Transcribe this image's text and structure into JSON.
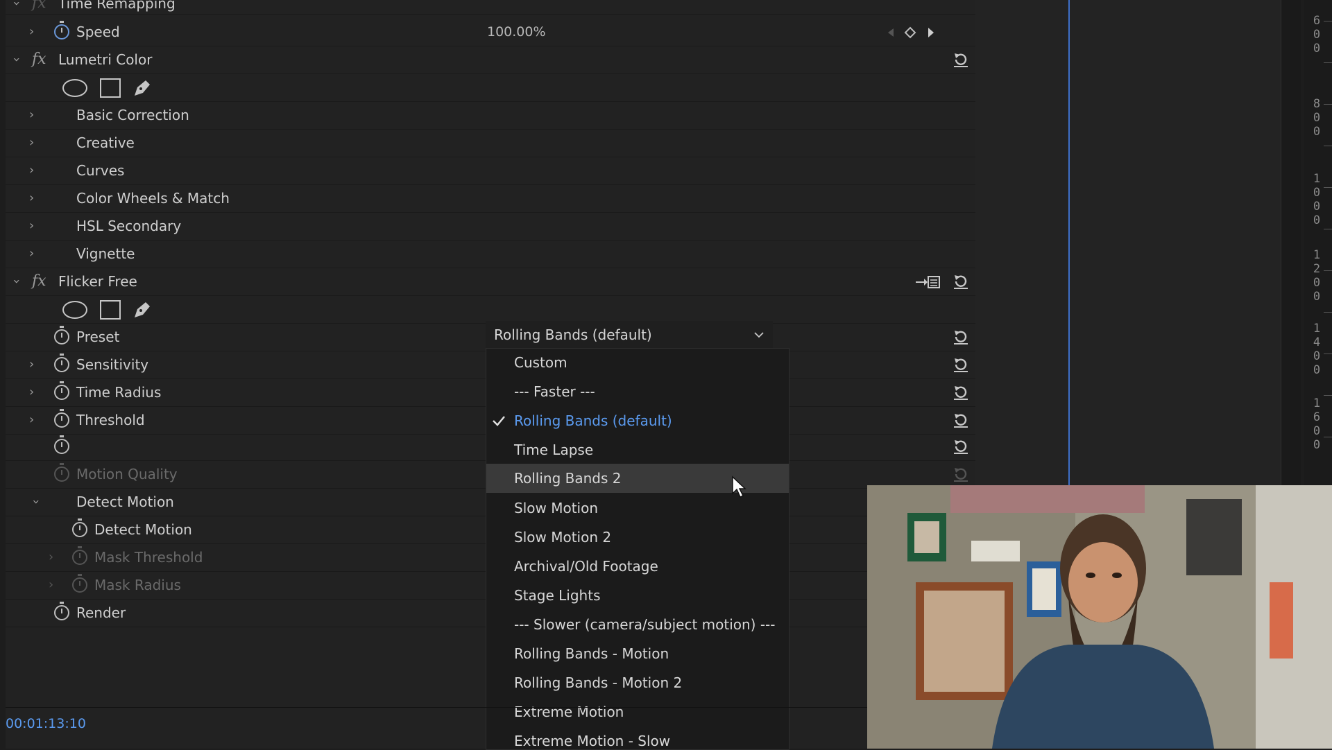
{
  "effect_controls": {
    "time_remapping": {
      "title": "Time Remapping",
      "fx_symbol": "fx",
      "speed_label": "Speed",
      "speed_value": "100.00%"
    },
    "lumetri": {
      "title": "Lumetri Color",
      "fx_symbol": "fx",
      "sections": [
        "Basic Correction",
        "Creative",
        "Curves",
        "Color Wheels & Match",
        "HSL Secondary",
        "Vignette"
      ]
    },
    "flicker_free": {
      "title": "Flicker Free",
      "fx_symbol": "fx",
      "preset_label": "Preset",
      "preset_value": "Rolling Bands (default)",
      "params": [
        "Sensitivity",
        "Time Radius",
        "Threshold"
      ],
      "motion_quality": "Motion Quality",
      "detect_motion_group": "Detect Motion",
      "detect_motion": "Detect Motion",
      "mask_threshold": "Mask Threshold",
      "mask_radius": "Mask Radius",
      "render": "Render"
    }
  },
  "preset_menu": {
    "items": [
      "Custom",
      "--- Faster ---",
      "Rolling Bands (default)",
      "Time Lapse",
      "Rolling Bands 2",
      "Slow Motion",
      "Slow Motion 2",
      "Archival/Old Footage",
      "Stage Lights",
      "--- Slower (camera/subject motion) ---",
      "Rolling Bands - Motion",
      "Rolling Bands - Motion 2",
      "Extreme Motion",
      "Extreme Motion - Slow"
    ],
    "selected": "Rolling Bands (default)",
    "hovered": "Rolling Bands 2"
  },
  "ruler_labels": [
    "6\n0\n0",
    "8\n0\n0",
    "1\n0\n0\n0",
    "1\n2\n0\n0",
    "1\n4\n0\n0",
    "1\n6\n0\n0"
  ],
  "timecode": "00:01:13:10",
  "colors": {
    "accent_blue": "#5b9bf0",
    "panel_bg": "#222222",
    "menu_bg": "#1b1b1b",
    "hover_bg": "#3a3a3a",
    "playhead": "#3e6fc8"
  },
  "icons": [
    "chevron-right-icon",
    "chevron-down-icon",
    "fx-icon",
    "stopwatch-icon",
    "reset-icon",
    "ellipse-mask-icon",
    "rectangle-mask-icon",
    "pen-mask-icon",
    "keyframe-nav-icon",
    "checkmark-icon",
    "mouse-cursor-icon",
    "export-list-icon"
  ]
}
